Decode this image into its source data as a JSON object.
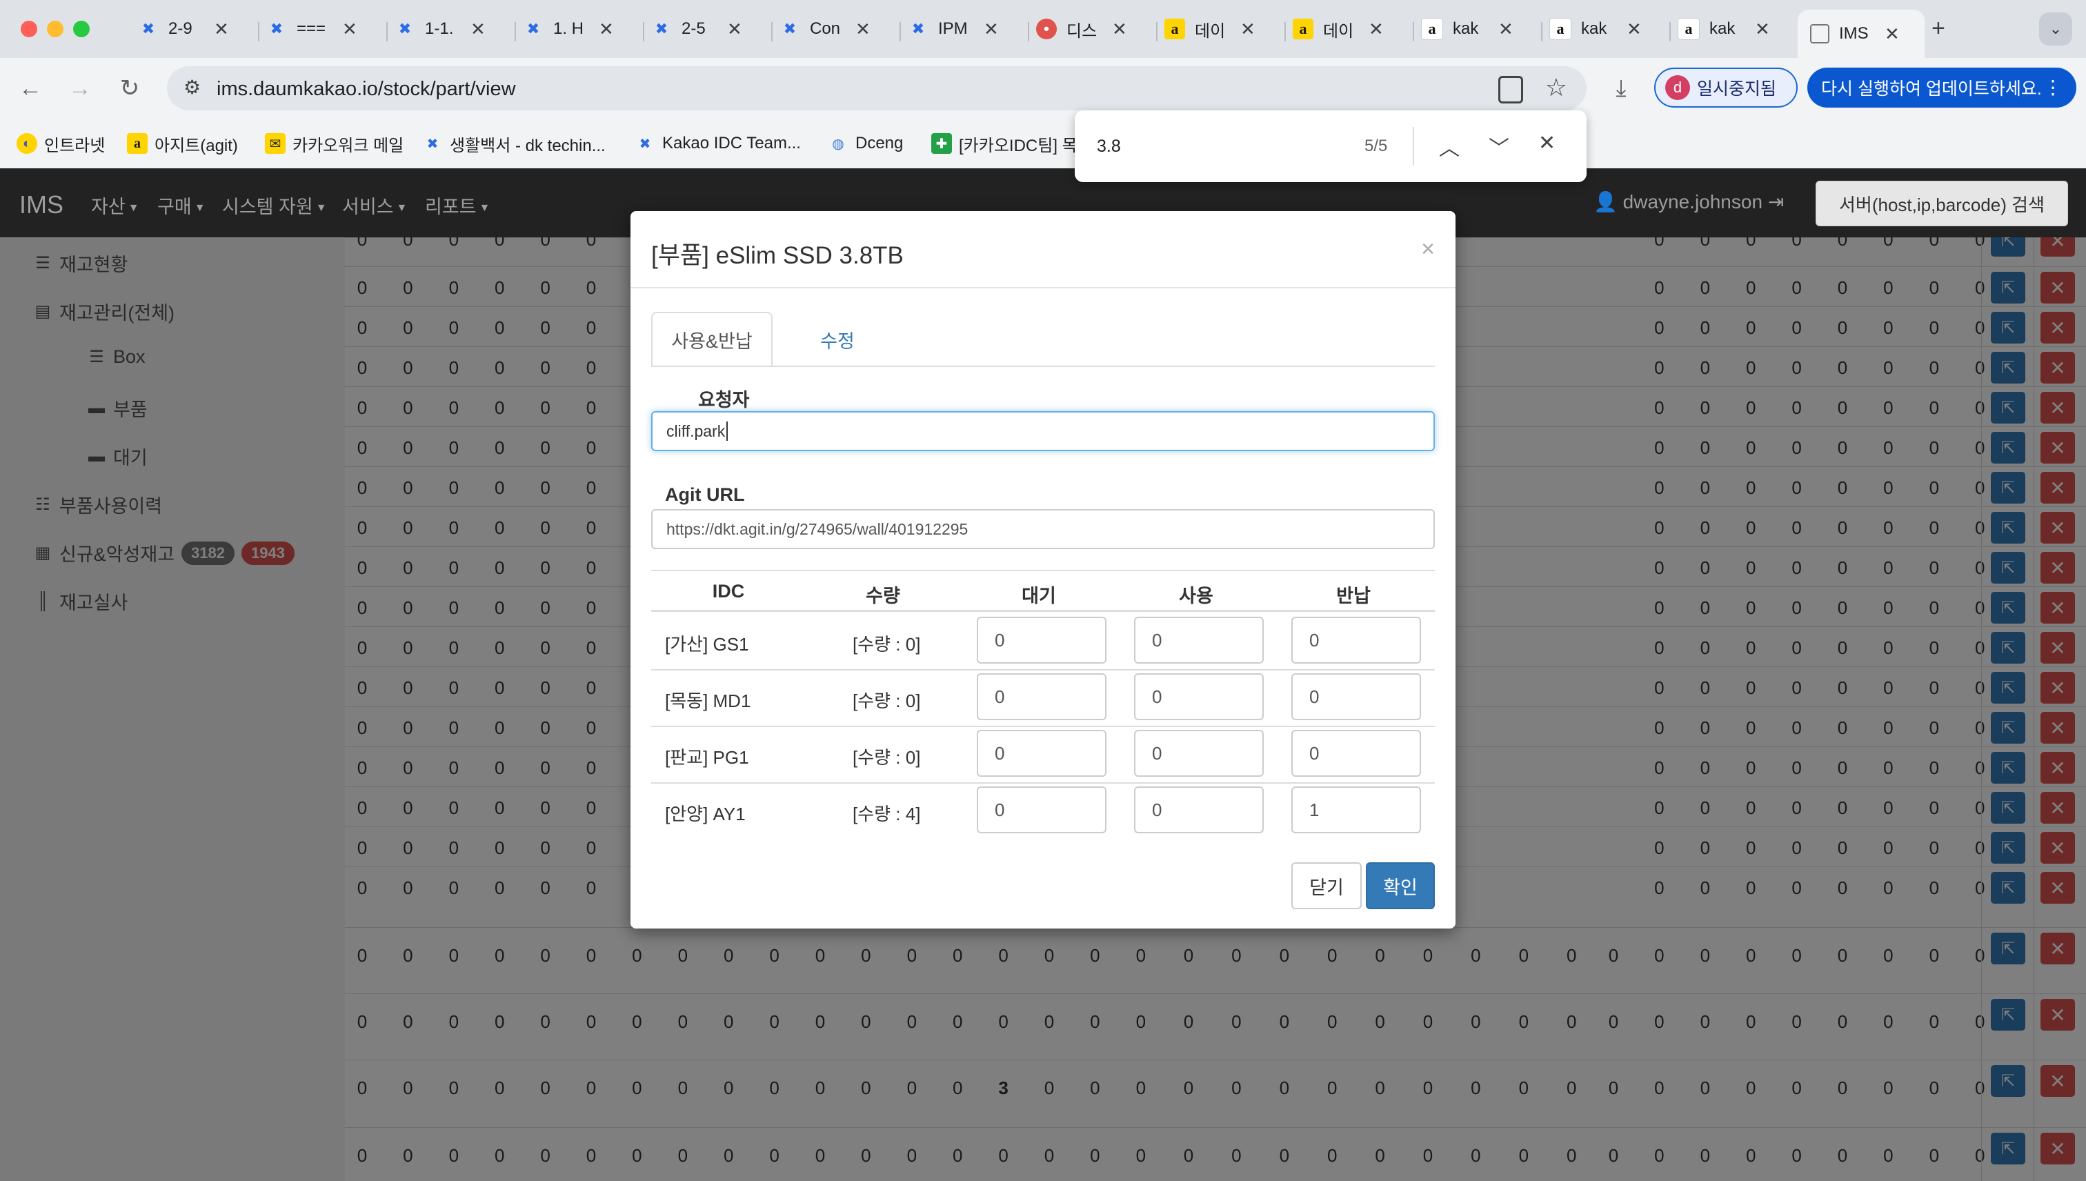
{
  "browser": {
    "tabs": [
      {
        "label": "2-9",
        "icon": "confluence-icon"
      },
      {
        "label": "===",
        "icon": "confluence-icon"
      },
      {
        "label": "1-1.",
        "icon": "confluence-icon"
      },
      {
        "label": "1. H",
        "icon": "confluence-icon"
      },
      {
        "label": "2-5",
        "icon": "confluence-icon"
      },
      {
        "label": "Con",
        "icon": "confluence-icon"
      },
      {
        "label": "IPM",
        "icon": "confluence-icon"
      },
      {
        "label": "디스",
        "icon": "discord-icon"
      },
      {
        "label": "데이",
        "icon": "agit-icon"
      },
      {
        "label": "데이",
        "icon": "agit-icon"
      },
      {
        "label": "kak",
        "icon": "kakao-a-icon"
      },
      {
        "label": "kak",
        "icon": "kakao-a-icon"
      },
      {
        "label": "kak",
        "icon": "kakao-a-icon"
      },
      {
        "label": "IMS",
        "icon": "page-icon",
        "active": true
      }
    ],
    "url": "ims.daumkakao.io/stock/part/view",
    "profile_initial": "d",
    "profile_status": "일시중지됨",
    "update_text": "다시 실행하여 업데이트하세요.",
    "bookmarks": [
      {
        "label": "인트라넷",
        "icon": "intranet-icon"
      },
      {
        "label": "아지트(agit)",
        "icon": "agit-icon"
      },
      {
        "label": "카카오워크 메일",
        "icon": "mail-icon"
      },
      {
        "label": "생활백서 - dk techin...",
        "icon": "confluence-icon"
      },
      {
        "label": "Kakao IDC Team...",
        "icon": "confluence-icon"
      },
      {
        "label": "Dceng",
        "icon": "globe-icon"
      },
      {
        "label": "[카카오IDC팀] 목",
        "icon": "sheet-icon"
      }
    ],
    "find": {
      "query": "3.8",
      "count": "5/5"
    }
  },
  "ims": {
    "brand": "IMS",
    "menus": [
      "자산",
      "구매",
      "시스템 자원",
      "서비스",
      "리포트"
    ],
    "user": "dwayne.johnson",
    "search_button": "서버(host,ip,barcode) 검색",
    "sidebar": [
      {
        "label": "재고현황",
        "icon": "server-icon"
      },
      {
        "label": "재고관리(전체)",
        "icon": "list-icon"
      },
      {
        "label": "Box",
        "icon": "box-icon"
      },
      {
        "label": "부품",
        "icon": "part-icon"
      },
      {
        "label": "대기",
        "icon": "part-icon"
      },
      {
        "label": "부품사용이력",
        "icon": "list-icon"
      },
      {
        "label": "신규&악성재고",
        "icon": "grid-icon",
        "badges": [
          "3182",
          "1943"
        ]
      },
      {
        "label": "재고실사",
        "icon": "barcode-icon"
      }
    ],
    "grid_zero": "0",
    "grid_highlight": "3"
  },
  "modal": {
    "title": "[부품] eSlim SSD 3.8TB",
    "close_glyph": "×",
    "tabs": [
      "사용&반납",
      "수정"
    ],
    "requester_label": "요청자",
    "requester_value": "cliff.park",
    "agit_label": "Agit URL",
    "agit_value": "https://dkt.agit.in/g/274965/wall/401912295",
    "table": {
      "headers": [
        "IDC",
        "수량",
        "대기",
        "사용",
        "반납"
      ],
      "rows": [
        {
          "idc": "[가산] GS1",
          "qty": "[수량 : 0]",
          "wait": "0",
          "use": "0",
          "ret": "0"
        },
        {
          "idc": "[목동] MD1",
          "qty": "[수량 : 0]",
          "wait": "0",
          "use": "0",
          "ret": "0"
        },
        {
          "idc": "[판교] PG1",
          "qty": "[수량 : 0]",
          "wait": "0",
          "use": "0",
          "ret": "0"
        },
        {
          "idc": "[안양] AY1",
          "qty": "[수량 : 4]",
          "wait": "0",
          "use": "0",
          "ret": "1"
        }
      ]
    },
    "close_button": "닫기",
    "confirm_button": "확인"
  },
  "colors": {
    "primary": "#337ab7",
    "danger": "#d9534f",
    "navbar": "#222222",
    "badge_gray": "#777777",
    "badge_red": "#d9534f"
  }
}
